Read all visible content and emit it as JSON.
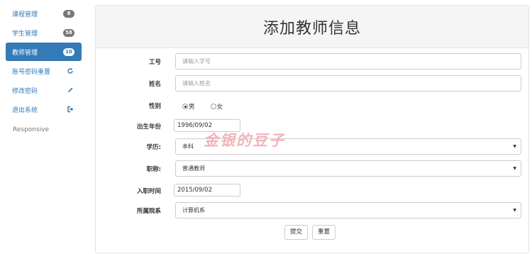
{
  "sidebar": {
    "items": [
      {
        "label": "课程管理",
        "badge": "8",
        "icon": "badge"
      },
      {
        "label": "学生管理",
        "badge": "58",
        "icon": "badge"
      },
      {
        "label": "教师管理",
        "badge": "10",
        "icon": "badge",
        "active": true
      },
      {
        "label": "账号密码重置",
        "icon": "refresh-icon"
      },
      {
        "label": "修改密码",
        "icon": "pencil-icon"
      },
      {
        "label": "退出系统",
        "icon": "logout-icon"
      }
    ],
    "footer_text": "Responsive"
  },
  "panel": {
    "title": "添加教师信息"
  },
  "form": {
    "id_label": "工号",
    "id_placeholder": "请输入学号",
    "name_label": "姓名",
    "name_placeholder": "请输入姓名",
    "gender_label": "性别",
    "gender_options": [
      "男",
      "女"
    ],
    "gender_selected": "男",
    "birth_label": "出生年份",
    "birth_value": "1996/09/02",
    "education_label": "学历:",
    "education_value": "本科",
    "title_label": "职称:",
    "title_value": "普通教师",
    "hire_label": "入职时间",
    "hire_value": "2015/09/02",
    "dept_label": "所属院系",
    "dept_value": "计算机系",
    "submit_label": "提交",
    "reset_label": "重置"
  },
  "watermark": "金银的豆子",
  "colors": {
    "primary": "#337ab7",
    "badge": "#777777",
    "watermark": "#f2b4b8"
  }
}
